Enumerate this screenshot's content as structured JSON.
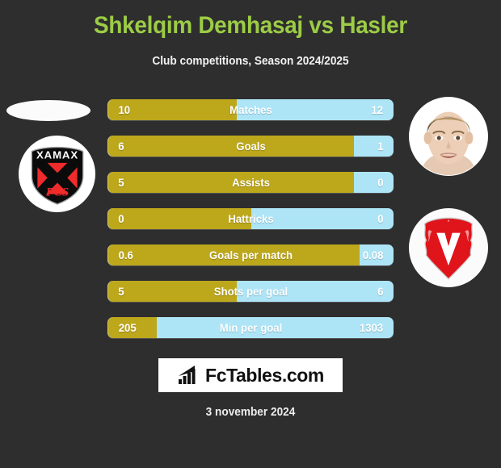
{
  "header": {
    "title": "Shkelqim Demhasaj vs Hasler",
    "subtitle": "Club competitions, Season 2024/2025",
    "title_color": "#9ccc46"
  },
  "colors": {
    "background": "#2e2e2e",
    "left_bar": "#bda71b",
    "right_bar": "#ade5f7",
    "text": "#ffffff"
  },
  "left_side": {
    "club_badge_name": "neuchatel-xamax-fcs-badge",
    "badge_primary_text": "XAMAX",
    "badge_secondary_text": "FCS"
  },
  "right_side": {
    "player_photo_name": "player-portrait-photo",
    "club_badge_name": "fc-vaduz-badge",
    "badge_letter": "V"
  },
  "chart_data": {
    "type": "bar",
    "title": "Shkelqim Demhasaj vs Hasler",
    "subtitle": "Club competitions, Season 2024/2025",
    "orientation": "horizontal-diverging",
    "categories": [
      "Matches",
      "Goals",
      "Assists",
      "Hattricks",
      "Goals per match",
      "Shots per goal",
      "Min per goal"
    ],
    "series": [
      {
        "name": "Shkelqim Demhasaj",
        "side": "left",
        "color": "#bda71b",
        "values": [
          "10",
          "6",
          "5",
          "0",
          "0.6",
          "5",
          "205"
        ]
      },
      {
        "name": "Hasler",
        "side": "right",
        "color": "#ade5f7",
        "values": [
          "12",
          "1",
          "0",
          "0",
          "0.08",
          "6",
          "1303"
        ]
      }
    ],
    "left_fill_percent": [
      45,
      86,
      86,
      50,
      88,
      45,
      17
    ],
    "legend_position": "none",
    "grid": false
  },
  "rows": [
    {
      "label": "Matches",
      "left": "10",
      "right": "12",
      "left_pct": 45
    },
    {
      "label": "Goals",
      "left": "6",
      "right": "1",
      "left_pct": 86
    },
    {
      "label": "Assists",
      "left": "5",
      "right": "0",
      "left_pct": 86
    },
    {
      "label": "Hattricks",
      "left": "0",
      "right": "0",
      "left_pct": 50
    },
    {
      "label": "Goals per match",
      "left": "0.6",
      "right": "0.08",
      "left_pct": 88
    },
    {
      "label": "Shots per goal",
      "left": "5",
      "right": "6",
      "left_pct": 45
    },
    {
      "label": "Min per goal",
      "left": "205",
      "right": "1303",
      "left_pct": 17
    }
  ],
  "footer": {
    "logo_text": "FcTables.com",
    "logo_icon_name": "bar-chart-growth-icon",
    "date": "3 november 2024"
  }
}
